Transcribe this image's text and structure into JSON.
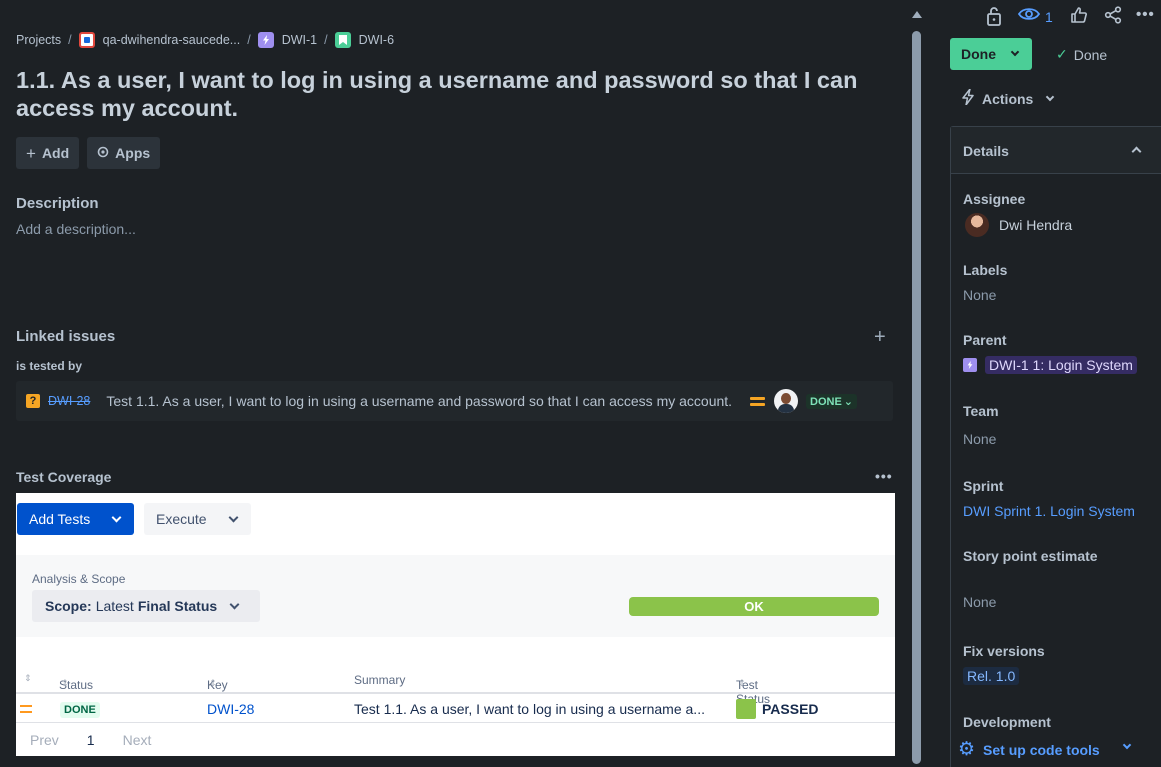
{
  "breadcrumb": {
    "projects": "Projects",
    "project": "qa-dwihendra-saucede...",
    "epic": "DWI-1",
    "issue": "DWI-6",
    "separator": "/"
  },
  "issue": {
    "title": "1.1. As a user, I want to log in using a username and password so that I can access my account.",
    "add_label": "Add",
    "apps_label": "Apps"
  },
  "description": {
    "heading": "Description",
    "placeholder": "Add a description..."
  },
  "linked_issues": {
    "heading": "Linked issues",
    "add_glyph": "+",
    "relation": "is tested by",
    "items": [
      {
        "type_glyph": "?",
        "key": "DWI-28",
        "summary": "Test 1.1. As a user, I want to log in using a username and password so that I can access my account.",
        "status": "DONE",
        "status_chevron": "⌄"
      }
    ]
  },
  "test_coverage": {
    "heading": "Test Coverage",
    "more_glyph": "•••",
    "add_tests_label": "Add Tests",
    "execute_label": "Execute",
    "analysis_label": "Analysis & Scope",
    "scope_prefix": "Scope:",
    "scope_middle": "Latest",
    "scope_value": "Final Status",
    "overall_status": "OK",
    "overall_color": "#8bc34a",
    "columns": [
      "Status",
      "Key",
      "Summary",
      "Test Status"
    ],
    "sort_glyph": "⇕",
    "rows": [
      {
        "status": "DONE",
        "key": "DWI-28",
        "summary": "Test 1.1. As a user, I want to log in using a username a...",
        "test_status": "PASSED"
      }
    ],
    "pager": {
      "prev": "Prev",
      "page": "1",
      "next": "Next"
    }
  },
  "sidebar": {
    "watchers_count": "1",
    "status_button": "Done",
    "resolution": "Done",
    "actions_label": "Actions",
    "details_heading": "Details",
    "fields": {
      "assignee_label": "Assignee",
      "assignee_value": "Dwi Hendra",
      "labels_label": "Labels",
      "labels_value": "None",
      "parent_label": "Parent",
      "parent_value": "DWI-1 1: Login System",
      "team_label": "Team",
      "team_value": "None",
      "sprint_label": "Sprint",
      "sprint_value": "DWI Sprint 1. Login System",
      "story_points_label": "Story point estimate",
      "story_points_value": "None",
      "fix_versions_label": "Fix versions",
      "fix_versions_value": "Rel. 1.0",
      "development_label": "Development",
      "development_action": "Set up code tools"
    }
  },
  "colors": {
    "background": "#1d2125",
    "done_green": "#4bce97",
    "link_blue": "#579dff",
    "xray_blue": "#0052cc",
    "medium_priority": "#f5a524"
  }
}
